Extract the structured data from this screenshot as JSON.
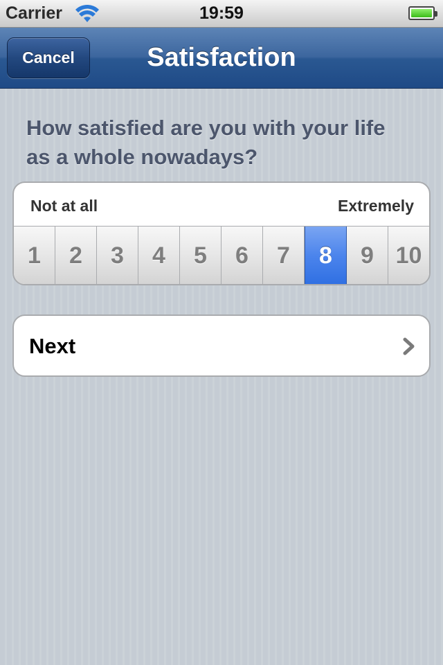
{
  "status_bar": {
    "carrier": "Carrier",
    "time": "19:59",
    "wifi_icon": "wifi-icon",
    "battery_icon": "battery-icon",
    "battery_level": 1.0
  },
  "nav": {
    "cancel_label": "Cancel",
    "title": "Satisfaction"
  },
  "question": {
    "text": "How satisfied are you with your life as a whole nowadays?"
  },
  "scale": {
    "min_label": "Not at all",
    "max_label": "Extremely",
    "options": [
      "1",
      "2",
      "3",
      "4",
      "5",
      "6",
      "7",
      "8",
      "9",
      "10"
    ],
    "selected": "8",
    "selected_color": "#3f7ce8"
  },
  "next": {
    "label": "Next",
    "icon": "chevron-right-icon"
  }
}
